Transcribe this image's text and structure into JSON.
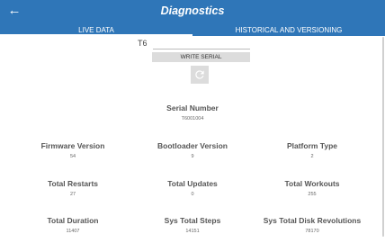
{
  "header": {
    "title": "Diagnostics",
    "back_icon": "arrow-left-icon",
    "back_glyph": "←"
  },
  "tabs": [
    {
      "label": "LIVE DATA",
      "active": true
    },
    {
      "label": "HISTORICAL AND VERSIONING",
      "active": false
    }
  ],
  "serial_entry": {
    "label": "T6",
    "value": "",
    "write_label": "WRITE SERIAL",
    "refresh_icon": "refresh-icon"
  },
  "metrics": {
    "serial_number": {
      "label": "Serial Number",
      "value": "T6001004"
    },
    "firmware_version": {
      "label": "Firmware Version",
      "value": "54"
    },
    "bootloader_version": {
      "label": "Bootloader Version",
      "value": "9"
    },
    "platform_type": {
      "label": "Platform Type",
      "value": "2"
    },
    "total_restarts": {
      "label": "Total Restarts",
      "value": "27"
    },
    "total_updates": {
      "label": "Total Updates",
      "value": "0"
    },
    "total_workouts": {
      "label": "Total Workouts",
      "value": "255"
    },
    "total_duration": {
      "label": "Total Duration",
      "value": "11407"
    },
    "sys_total_steps": {
      "label": "Sys Total Steps",
      "value": "14151"
    },
    "sys_total_disk_revolutions": {
      "label": "Sys Total Disk Revolutions",
      "value": "78170"
    }
  },
  "colors": {
    "appbar": "#2f76b8",
    "button": "#dcdcdc",
    "text": "#555555"
  }
}
